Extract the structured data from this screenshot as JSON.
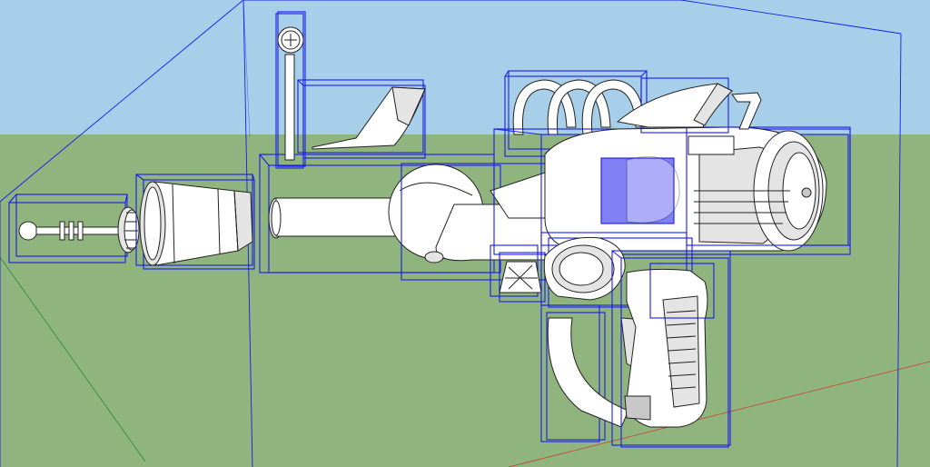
{
  "viewport": {
    "sky_color": "#a7cfe9",
    "ground_color": "#8fb47e",
    "selection_color": "#1a1aee",
    "model_fill": "#ffffff",
    "edge_color": "#222222",
    "axis_red": "#c0392b",
    "axis_green": "#2e8b2e",
    "axis_blue": "#2233cc"
  },
  "model": {
    "components": [
      "emitter-rod",
      "emitter-gear",
      "cone-nozzle",
      "coupler-tube",
      "barrel-bulb",
      "main-barrel",
      "rear-sight",
      "top-fin",
      "coil-rings",
      "drum-housing",
      "mesh-window",
      "rear-ratchet",
      "carry-handle",
      "trigger-guard",
      "grip"
    ]
  }
}
